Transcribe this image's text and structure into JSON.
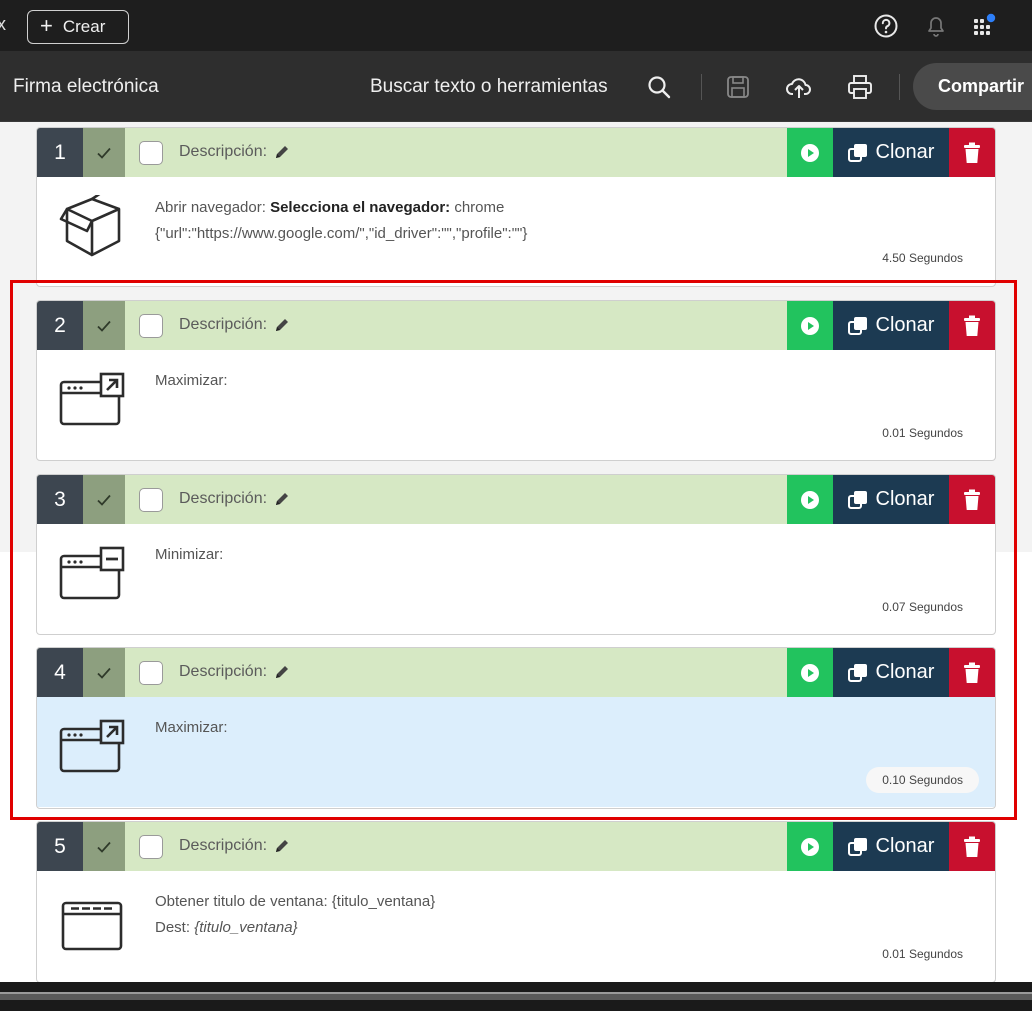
{
  "topbar": {
    "close_glyph": "x",
    "create_label": "Crear",
    "icons": [
      "help-icon",
      "bell-icon",
      "apps-grid-icon"
    ]
  },
  "toolbar": {
    "doc_title": "Firma electrónica",
    "search_label": "Buscar texto o herramientas",
    "share_label": "Compartir"
  },
  "steps": [
    {
      "num": "1",
      "desc": "Descripción:",
      "clone_label": "Clonar",
      "action": "Abrir navegador:",
      "param_label": "Selecciona el navegador:",
      "param_value": "chrome",
      "line2": "{\"url\":\"https://www.google.com/\",\"id_driver\":\"\",\"profile\":\"\"}",
      "secs": "4.50 Segundos",
      "icon": "box-icon"
    },
    {
      "num": "2",
      "desc": "Descripción:",
      "clone_label": "Clonar",
      "action": "Maximizar:",
      "secs": "0.01 Segundos",
      "icon": "window-maximize-icon"
    },
    {
      "num": "3",
      "desc": "Descripción:",
      "clone_label": "Clonar",
      "action": "Minimizar:",
      "secs": "0.07 Segundos",
      "icon": "window-minimize-icon"
    },
    {
      "num": "4",
      "desc": "Descripción:",
      "clone_label": "Clonar",
      "action": "Maximizar:",
      "secs": "0.10 Segundos",
      "icon": "window-maximize-icon",
      "selected": true
    },
    {
      "num": "5",
      "desc": "Descripción:",
      "clone_label": "Clonar",
      "action": "Obtener titulo de ventana: {titulo_ventana}",
      "dest_label": "Dest:",
      "dest_value": "{titulo_ventana}",
      "secs": "0.01 Segundos",
      "icon": "window-title-icon"
    }
  ],
  "colors": {
    "header_green": "#d6e8c4",
    "num_dark": "#3d4650",
    "play_green": "#22c35e",
    "clone_navy": "#1c3a52",
    "delete_red": "#c8102e",
    "highlight_red": "#e00000",
    "selected_blue": "#dceefc"
  }
}
